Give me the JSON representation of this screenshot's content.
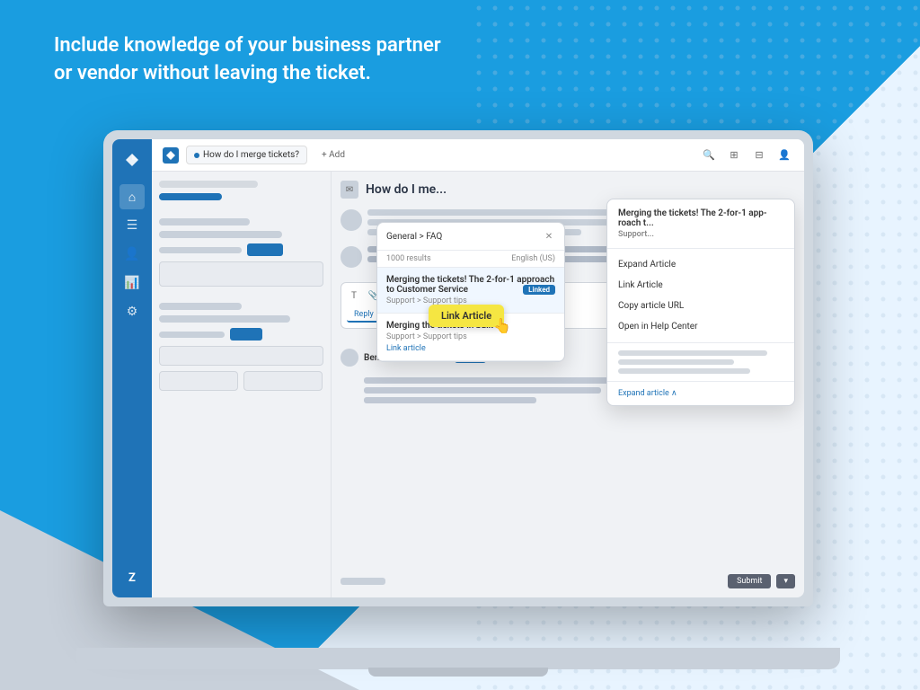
{
  "background": {
    "blue_color": "#1a9de0",
    "gray_color": "#c8d4dc"
  },
  "tagline": {
    "line1": "Include knowledge of your business partner",
    "line2": "or vendor without leaving the ticket."
  },
  "sidebar": {
    "icons": [
      "✦",
      "⌂",
      "☰",
      "👤",
      "📊",
      "⚙"
    ],
    "bottom_icon": "Z"
  },
  "topbar": {
    "tab_text": "How do I merge tickets?",
    "add_label": "+ Add",
    "actions": [
      "🔍",
      "⊞",
      "⊟",
      "👤"
    ]
  },
  "ticket": {
    "title": "How do I me...",
    "ben_name": "Ben Peters",
    "ben_tag": "Linked"
  },
  "kb_panel": {
    "search_text": "General > FAQ",
    "results_count": "1000 results",
    "language": "English (US)",
    "result1": {
      "title": "Merging the tickets! The 2-for-1 approach to Customer Service",
      "meta": "Support  >  Support tips",
      "badge": "Linked"
    },
    "result2": {
      "title": "Merging the tickets in bulk",
      "meta": "Support  >  Support tips",
      "action": "Link article"
    }
  },
  "article_panel": {
    "title": "Merging the tickets! The 2-for-1 app-roach t...",
    "meta": "Support...",
    "actions": [
      "Expand Article",
      "Link Article",
      "Copy article URL",
      "Open in Help Center"
    ],
    "expand_label": "Expand article ∧"
  },
  "tooltip": {
    "label": "Link Article"
  }
}
